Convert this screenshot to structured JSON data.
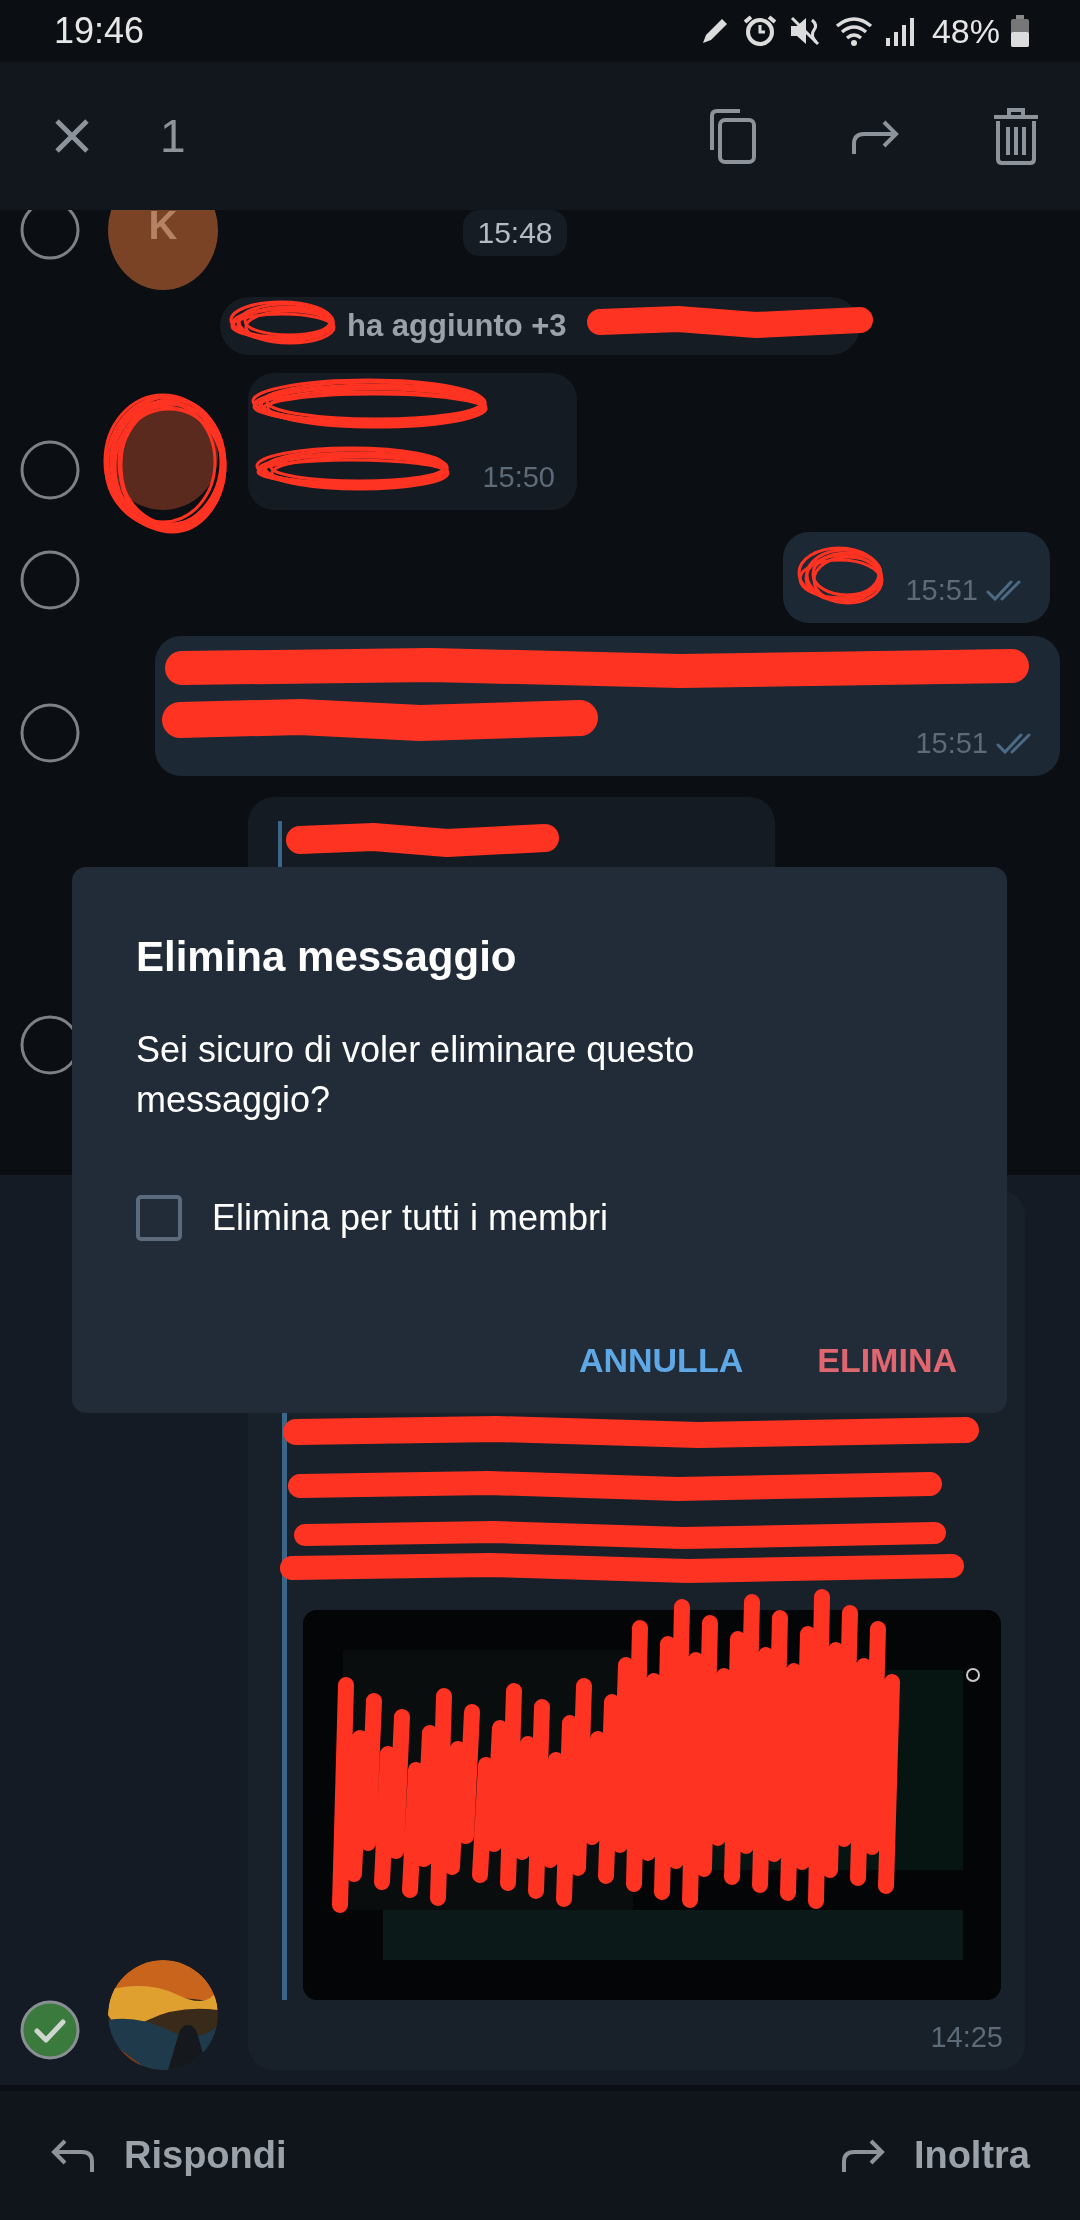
{
  "status_bar": {
    "time": "19:46",
    "battery": "48%"
  },
  "action_bar": {
    "selected_count": "1"
  },
  "chat": [
    {
      "kind": "date",
      "text": "15:48",
      "avatar_letter": "K",
      "selected": false
    },
    {
      "kind": "service",
      "text": "ha aggiunto +3"
    },
    {
      "kind": "incoming",
      "time": "15:50",
      "selected": false
    },
    {
      "kind": "outgoing",
      "time": "15:51",
      "read": true,
      "selected": false
    },
    {
      "kind": "paragraph",
      "time": "15:51",
      "read": true,
      "selected": false
    },
    {
      "kind": "reply",
      "selected": false
    },
    {
      "kind": "preview",
      "time": "14:25",
      "selected": true
    }
  ],
  "dialog": {
    "title": "Elimina messaggio",
    "message": "Sei sicuro di voler eliminare questo messaggio?",
    "checkbox": {
      "label": "Elimina per tutti i membri",
      "checked": false
    },
    "buttons": [
      {
        "label": "ANNULLA",
        "kind": "cancel"
      },
      {
        "label": "ELIMINA",
        "kind": "danger"
      }
    ]
  },
  "bottom_bar": {
    "reply": "Rispondi",
    "forward": "Inoltra"
  }
}
